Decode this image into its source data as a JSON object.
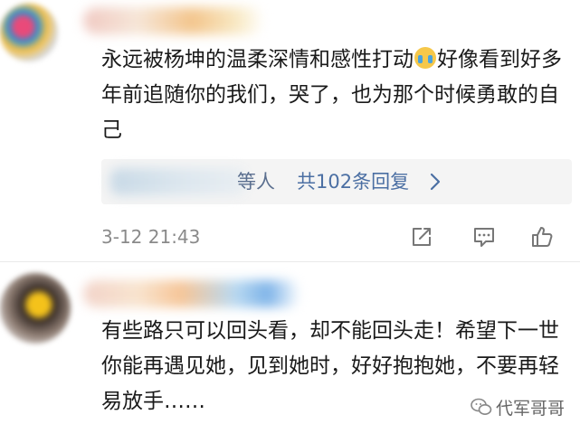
{
  "comments": [
    {
      "text_before_emoji": "永远被杨坤的温柔深情和感性打动",
      "emoji": "crying-face-emoji",
      "text_after_emoji": "好像看到好多年前追随你的我们，哭了，也为那个时候勇敢的自己",
      "replies": {
        "name_suffix": "等人",
        "count_label": "共102条回复"
      },
      "timestamp": "3-12 21:43"
    },
    {
      "text": "有些路只可以回头看，却不能回头走！希望下一世你能再遇见她，见到她时，好好抱抱她，不要再轻易放手……"
    }
  ],
  "watermark": "代军哥哥",
  "colors": {
    "text": "#1a1a1a",
    "link": "#4b6fa3",
    "meta": "#8a8a8a",
    "reply_bg": "#f4f4f4"
  }
}
